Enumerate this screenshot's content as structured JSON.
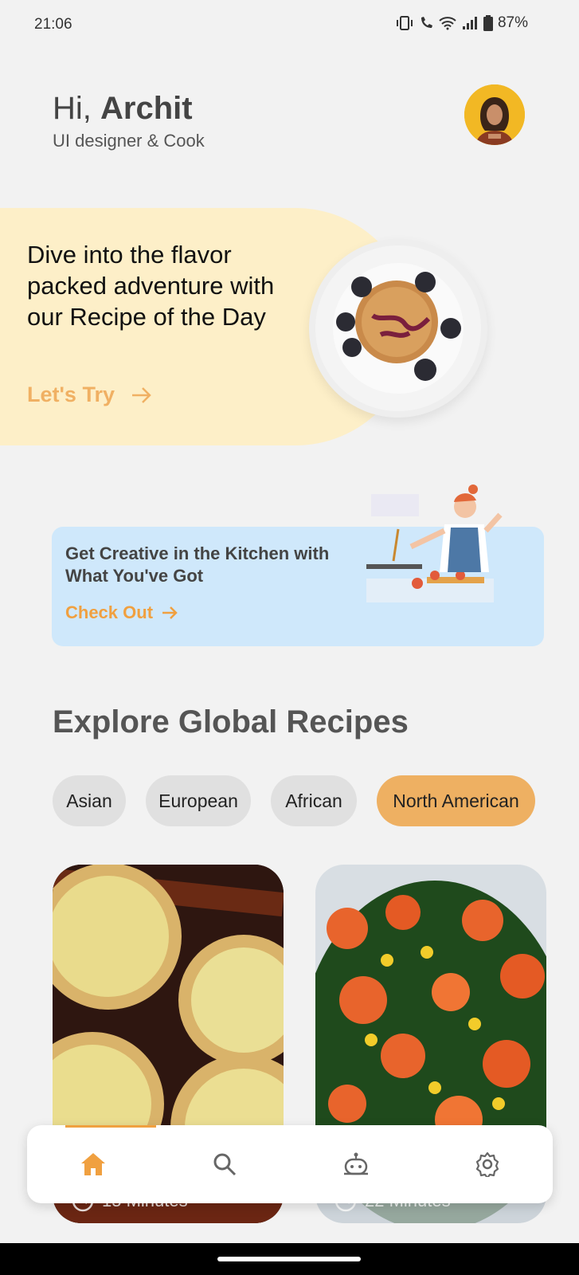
{
  "status": {
    "time": "21:06",
    "battery": "87%"
  },
  "greeting": {
    "hi": "Hi,",
    "name": "Archit",
    "subtitle": "UI designer & Cook"
  },
  "hero": {
    "text": "Dive into the flavor packed adventure with our Recipe of the Day",
    "cta": "Let's Try"
  },
  "promo": {
    "title": "Get Creative in the Kitchen with What You've Got",
    "cta": "Check Out"
  },
  "explore": {
    "title": "Explore Global Recipes",
    "chips": [
      "Asian",
      "European",
      "African",
      "North American"
    ],
    "active_chip": "North American"
  },
  "recipes": [
    {
      "time": "15 Minutes"
    },
    {
      "time": "22 Minutes"
    }
  ],
  "nav": {
    "items": [
      "home-icon",
      "search-icon",
      "chef-bot-icon",
      "gear-icon"
    ],
    "active": "home-icon"
  },
  "colors": {
    "accent": "#f0a040",
    "hero_bg": "#fdefc8",
    "promo_bg": "#cfe8fb",
    "chip_active": "#eeb062"
  }
}
